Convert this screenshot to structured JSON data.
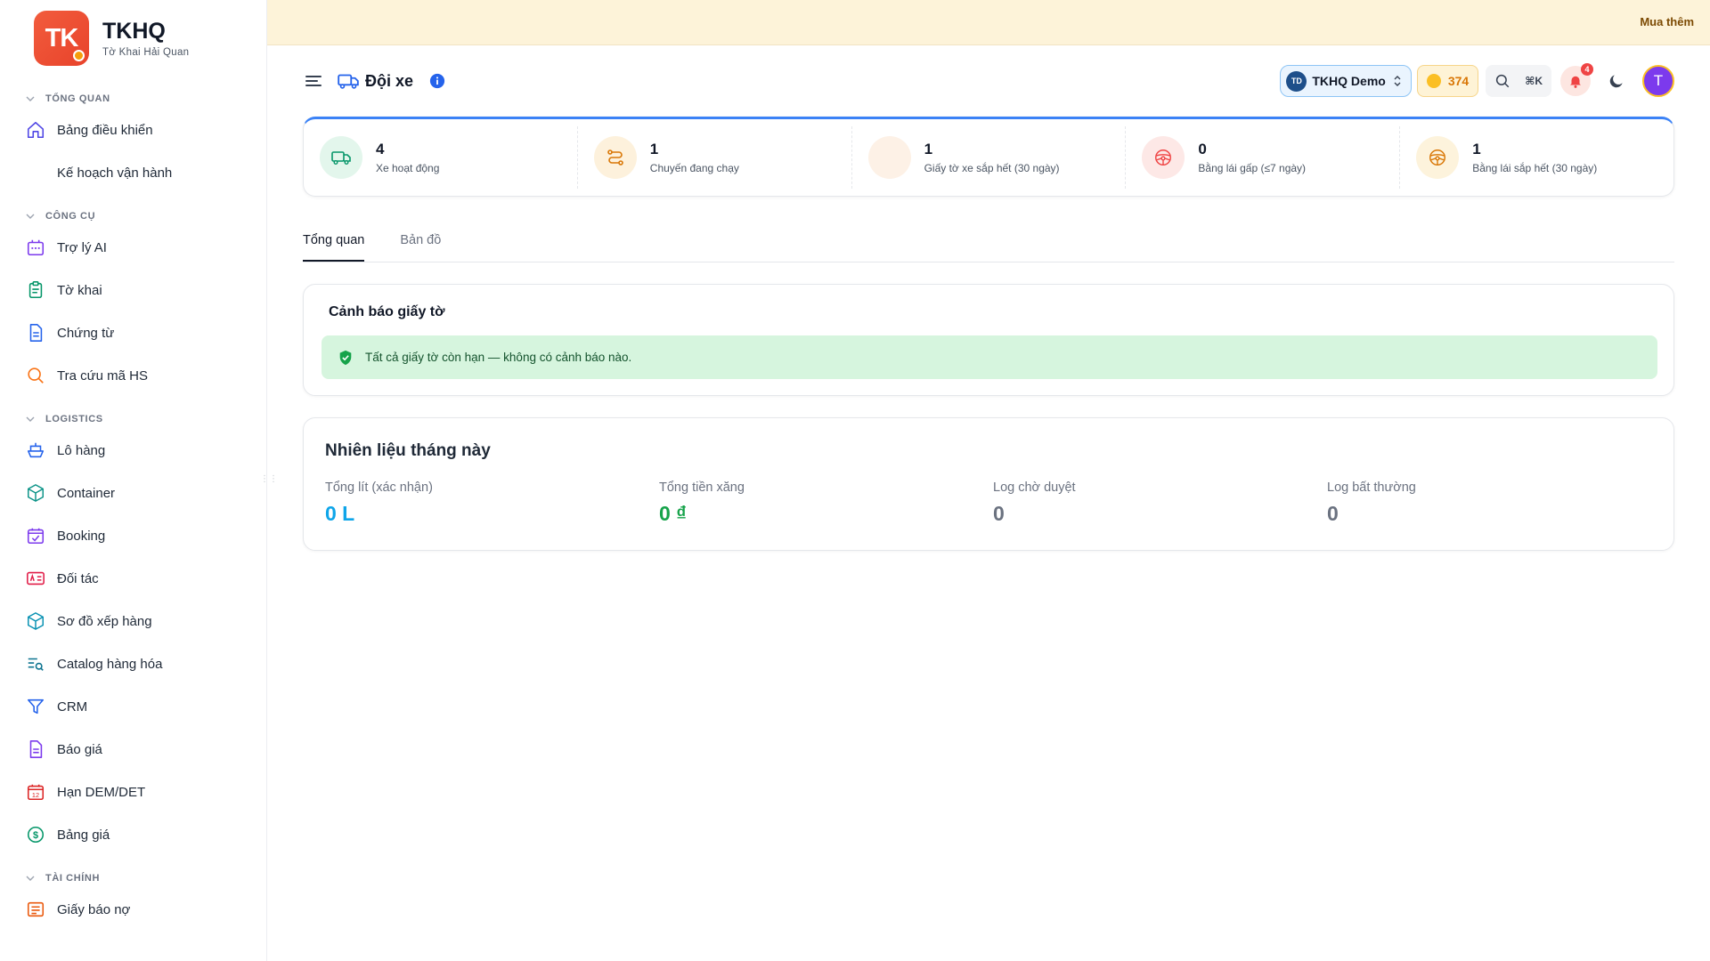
{
  "brand": {
    "initials": "TK",
    "name": "TKHQ",
    "subtitle": "Tờ Khai Hải Quan"
  },
  "topbar": {
    "buy_label": "Mua thêm"
  },
  "sidebar": {
    "sections": [
      {
        "label": "TỔNG QUAN",
        "items": [
          {
            "label": "Bảng điều khiển",
            "icon": "home-icon"
          },
          {
            "label": "Kế hoạch vận hành",
            "icon": ""
          }
        ]
      },
      {
        "label": "CÔNG CỤ",
        "items": [
          {
            "label": "Trợ lý AI",
            "icon": "bot-icon"
          },
          {
            "label": "Tờ khai",
            "icon": "clipboard-icon"
          },
          {
            "label": "Chứng từ",
            "icon": "document-icon"
          },
          {
            "label": "Tra cứu mã HS",
            "icon": "search-icon"
          }
        ]
      },
      {
        "label": "LOGISTICS",
        "items": [
          {
            "label": "Lô hàng",
            "icon": "ship-icon"
          },
          {
            "label": "Container",
            "icon": "box-icon"
          },
          {
            "label": "Booking",
            "icon": "calendar-check-icon"
          },
          {
            "label": "Đối tác",
            "icon": "id-card-icon"
          },
          {
            "label": "Sơ đồ xếp hàng",
            "icon": "cube-icon"
          },
          {
            "label": "Catalog hàng hóa",
            "icon": "list-search-icon"
          },
          {
            "label": "CRM",
            "icon": "funnel-icon"
          },
          {
            "label": "Báo giá",
            "icon": "file-text-icon"
          },
          {
            "label": "Hạn DEM/DET",
            "icon": "calendar-12-icon"
          },
          {
            "label": "Bảng giá",
            "icon": "dollar-circle-icon"
          }
        ]
      },
      {
        "label": "TÀI CHÍNH",
        "items": [
          {
            "label": "Giấy báo nợ",
            "icon": "receipt-icon"
          }
        ]
      }
    ]
  },
  "header": {
    "title": "Đội xe",
    "org_initials": "TD",
    "org_name": "TKHQ Demo",
    "coins": "374",
    "search_shortcut": "⌘K",
    "notification_count": "4",
    "user_initial": "T"
  },
  "stats": [
    {
      "value": "4",
      "label": "Xe hoạt động",
      "icon": "truck-icon",
      "color": "#e3f6ec"
    },
    {
      "value": "1",
      "label": "Chuyến đang chạy",
      "icon": "route-icon",
      "color": "#fdf1dc"
    },
    {
      "value": "1",
      "label": "Giấy tờ xe sắp hết (30 ngày)",
      "icon": "",
      "color": "#fdf1e6"
    },
    {
      "value": "0",
      "label": "Bằng lái gấp (≤7 ngày)",
      "icon": "steering-wheel-icon",
      "color": "#fde8e6"
    },
    {
      "value": "1",
      "label": "Bằng lái sắp hết (30 ngày)",
      "icon": "steering-wheel-icon",
      "color": "#fdf3dc"
    }
  ],
  "tabs": [
    {
      "label": "Tổng quan",
      "active": true
    },
    {
      "label": "Bản đồ",
      "active": false
    }
  ],
  "documents_card": {
    "title": "Cảnh báo giấy tờ",
    "alert": "Tất cả giấy tờ còn hạn — không có cảnh báo nào."
  },
  "fuel_card": {
    "title": "Nhiên liệu tháng này",
    "metrics": [
      {
        "label": "Tổng lít (xác nhận)",
        "value": "0 L",
        "color": "#0ea5e9"
      },
      {
        "label": "Tổng tiền xăng",
        "value": "0 ₫",
        "color": "#16a34a"
      },
      {
        "label": "Log chờ duyệt",
        "value": "0",
        "color": "#6b7280"
      },
      {
        "label": "Log bất thường",
        "value": "0",
        "color": "#6b7280"
      }
    ]
  }
}
